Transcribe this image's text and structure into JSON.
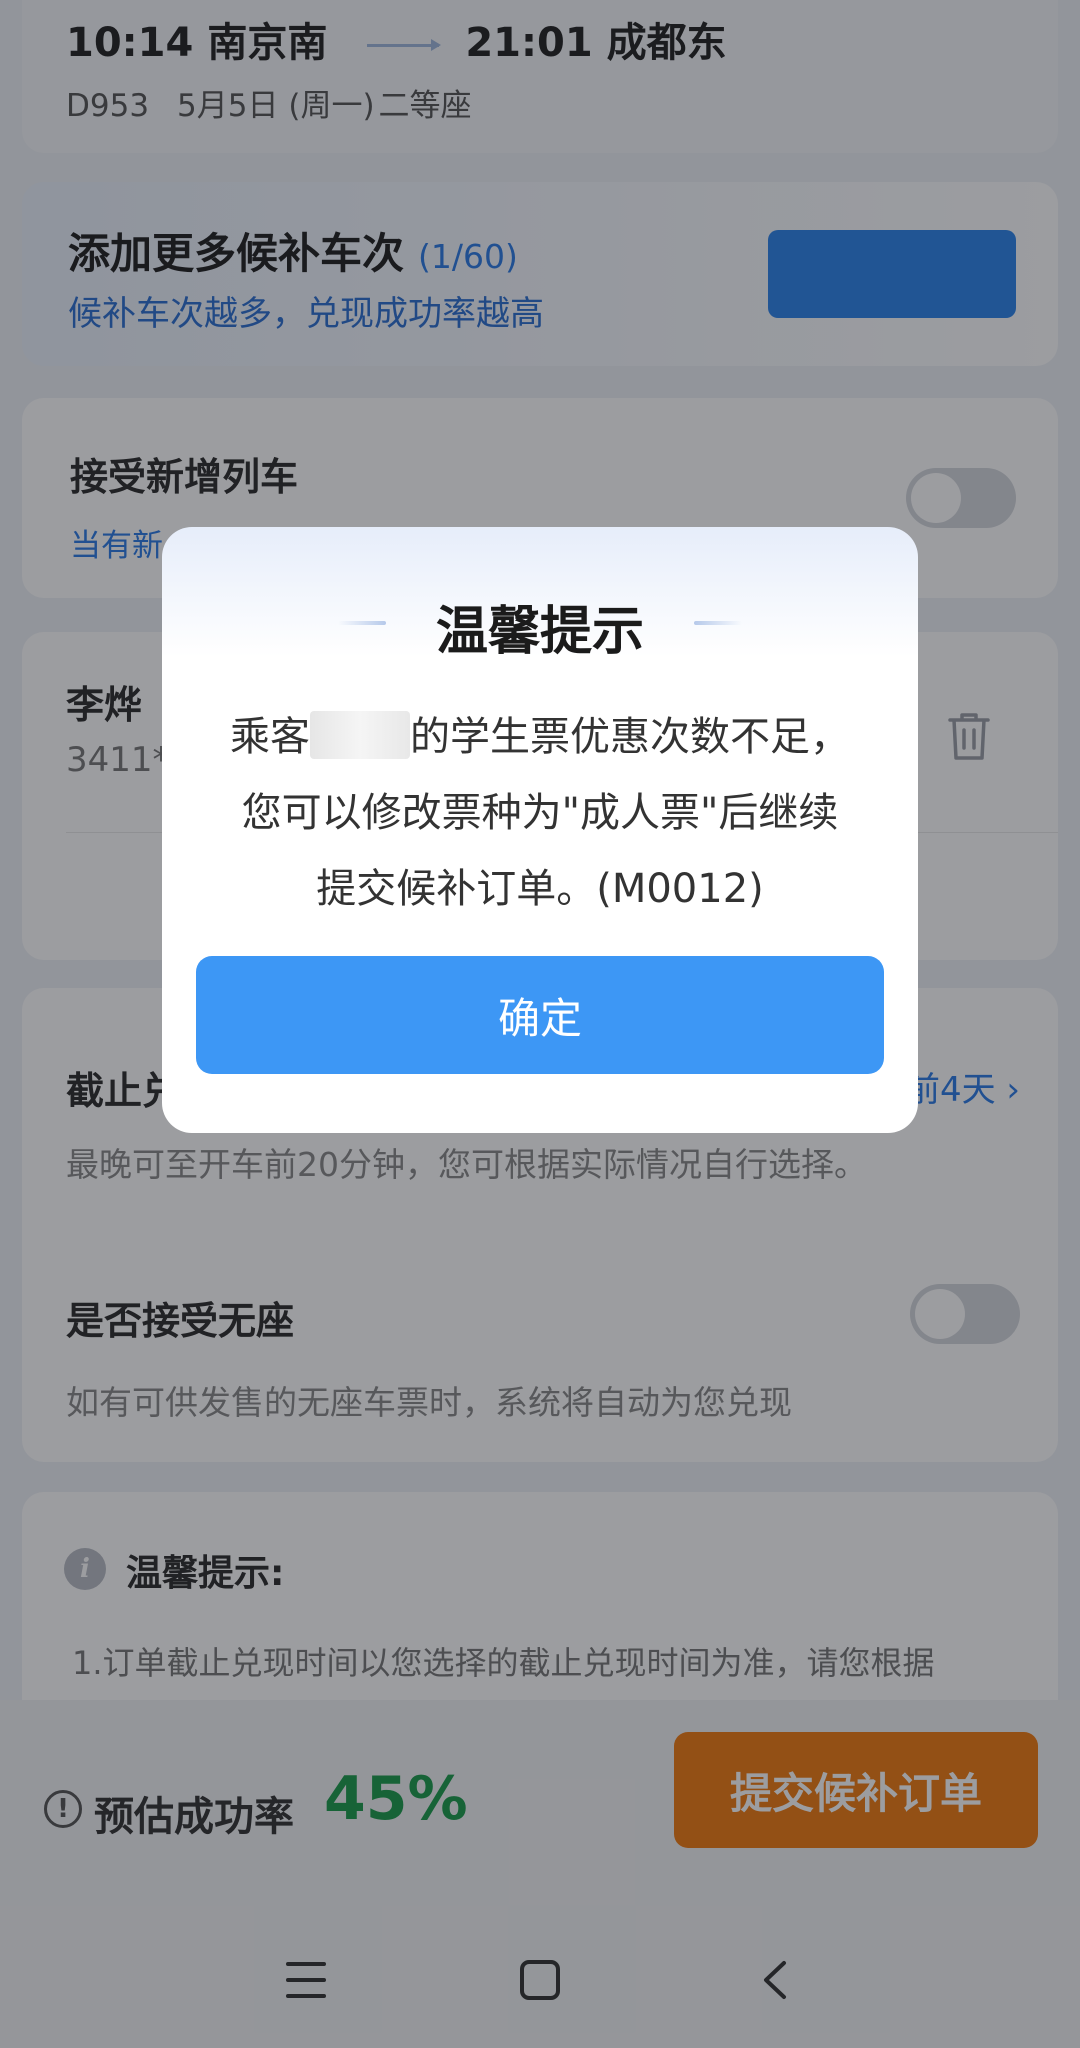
{
  "trip": {
    "depart_time": "10:14",
    "depart_station": "南京南",
    "arrive_time": "21:01",
    "arrive_station": "成都东",
    "train_no": "D953",
    "date": "5月5日 (周一)",
    "seat_class": "二等座"
  },
  "add_more": {
    "title": "添加更多候补车次",
    "count": "(1/60)",
    "subtitle": "候补车次越多，兑现成功率越高"
  },
  "accept_new_train": {
    "title": "接受新增列车",
    "subtitle": "当有新"
  },
  "passenger": {
    "name": "李烨",
    "id_prefix": "3411**"
  },
  "deadline": {
    "title": "截止兑",
    "value": "前4天",
    "subtitle": "最晚可至开车前20分钟，您可根据实际情况自行选择。"
  },
  "no_seat": {
    "title": "是否接受无座",
    "subtitle": "如有可供发售的无座车票时，系统将自动为您兑现"
  },
  "tips": {
    "title": "温馨提示:",
    "line1": "1.订单截止兑现时间以您选择的截止兑现时间为准，请您根据"
  },
  "bottom_bar": {
    "label": "预估成功率",
    "rate": "45%",
    "submit_label": "提交候补订单"
  },
  "dialog": {
    "title": "温馨提示",
    "body_pre": "乘客",
    "body_post": "的学生票优惠次数不足，",
    "body_line2": "您可以修改票种为\"成人票\"后继续",
    "body_line3": "提交候补订单。(M0012)",
    "confirm_label": "确定"
  },
  "colors": {
    "accent_blue": "#3d97f5",
    "link_blue": "#2c7be5",
    "success_green": "#1a9b4b",
    "submit_orange": "#f07a10"
  }
}
